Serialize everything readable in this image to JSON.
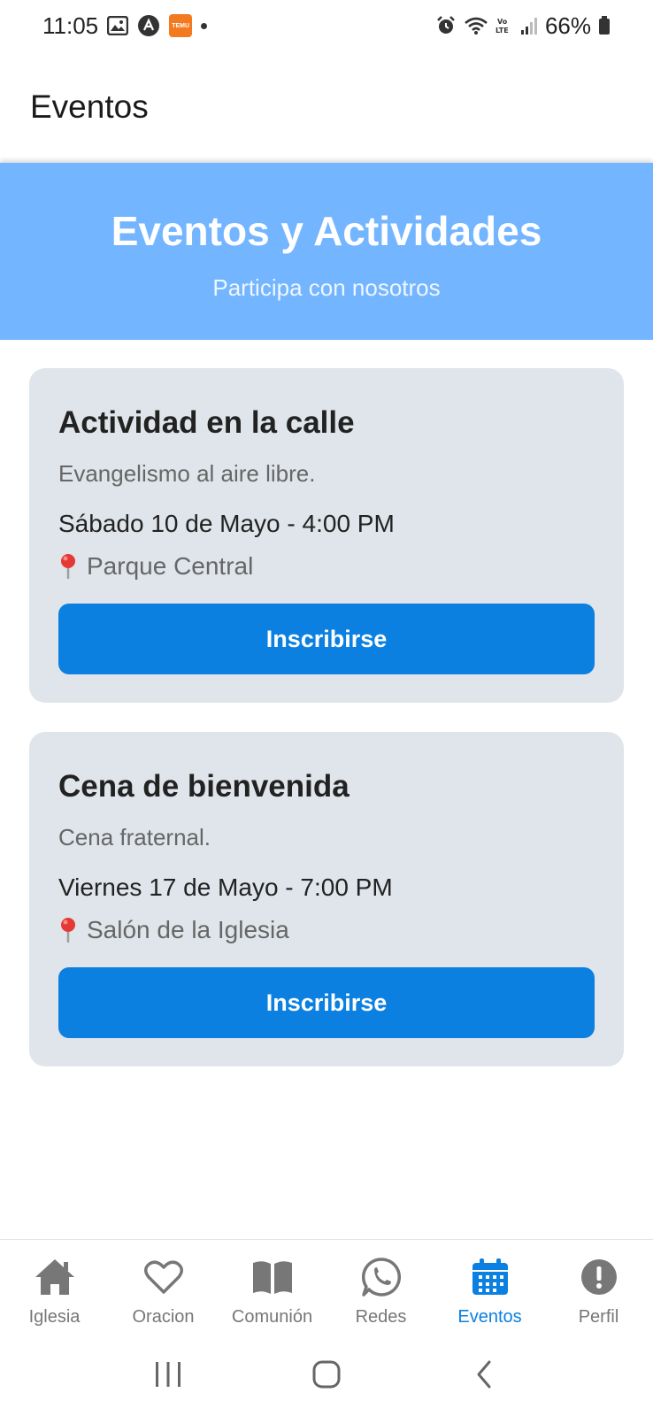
{
  "status_bar": {
    "time": "11:05",
    "battery": "66%",
    "notification_icons": [
      "gallery-icon",
      "app-icon",
      "temu-icon",
      "dot-icon"
    ],
    "temu_text": "TEMU",
    "system_icons": [
      "alarm-icon",
      "wifi-icon",
      "volte-icon",
      "signal-icon",
      "battery-icon"
    ]
  },
  "app_bar": {
    "title": "Eventos"
  },
  "hero": {
    "title": "Eventos y Actividades",
    "subtitle": "Participa con nosotros",
    "color": "#74b5ff"
  },
  "events": [
    {
      "title": "Actividad en la calle",
      "description": "Evangelismo al aire libre.",
      "date": "Sábado 10 de Mayo - 4:00 PM",
      "location": "Parque Central",
      "button_label": "Inscribirse"
    },
    {
      "title": "Cena de bienvenida",
      "description": "Cena fraternal.",
      "date": "Viernes 17 de Mayo - 7:00 PM",
      "location": "Salón de la Iglesia",
      "button_label": "Inscribirse"
    }
  ],
  "bottom_nav": {
    "active": "Eventos",
    "active_color": "#0b80e0",
    "items": [
      {
        "label": "Iglesia",
        "icon": "home-icon"
      },
      {
        "label": "Oracion",
        "icon": "heart-icon"
      },
      {
        "label": "Comunión",
        "icon": "book-icon"
      },
      {
        "label": "Redes",
        "icon": "whatsapp-icon"
      },
      {
        "label": "Eventos",
        "icon": "calendar-icon"
      },
      {
        "label": "Perfil",
        "icon": "alert-circle-icon"
      }
    ]
  },
  "system_nav": {
    "buttons": [
      "recents-icon",
      "home-button-icon",
      "back-icon"
    ]
  }
}
